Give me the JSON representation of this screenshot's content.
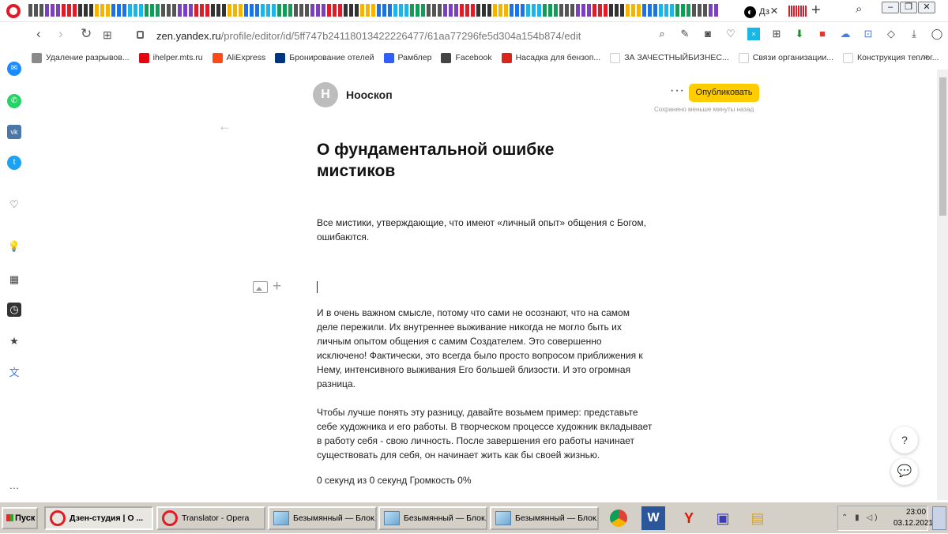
{
  "browser": {
    "active_tab_label": "Дз",
    "url_host": "zen.yandex.ru",
    "url_path": "/profile/editor/id/5ff747b24118013422226477/61aa77296fe5d304a154b874/edit"
  },
  "bookmarks": [
    {
      "label": "Удаление разрывов...",
      "color": "#8a8a8a"
    },
    {
      "label": "ihelper.mts.ru",
      "color": "#e30611"
    },
    {
      "label": "AliExpress",
      "color": "#ff4a17"
    },
    {
      "label": "Бронирование отелей",
      "color": "#003580"
    },
    {
      "label": "Рамблер",
      "color": "#315efb"
    },
    {
      "label": "Facebook",
      "color": "#444444"
    },
    {
      "label": "Насадка для бензоп...",
      "color": "#d9261c"
    },
    {
      "label": "ЗА ЗАЧЕСТНЫЙБИЗНЕС...",
      "color": "#ffffff"
    },
    {
      "label": "Связи организации...",
      "color": "#ffffff"
    },
    {
      "label": "Конструкция теплог...",
      "color": "#ffffff"
    }
  ],
  "editor": {
    "avatar_letter": "Н",
    "channel_name": "Нооскоп",
    "publish_label": "Опубликовать",
    "saved_status": "Сохранено меньше минуты назад",
    "more_label": "···",
    "title": "О фундаментальной ошибке мистиков",
    "paragraphs": [
      "Все мистики, утверждающие, что имеют «личный опыт» общения с Богом, ошибаются.",
      "И в очень важном смысле, потому что сами не осознают, что на самом деле пережили. Их внутреннее выживание никогда не могло быть их личным опытом общения с самим Создателем. Это совершенно исключено! Фактически, это всегда было просто вопросом приближения к Нему, интенсивного выживания Его большей близости. И это огромная разница.",
      "Чтобы лучше понять эту разницу, давайте возьмем пример: представьте себе художника и его работы. В творческом процессе художник вкладывает в работу себя - свою личность. После завершения его работы начинает существовать для себя, он начинает жить как бы своей жизнью."
    ],
    "media_status": "0 секунд из 0 секунд Громкость 0%",
    "help_label": "?"
  },
  "taskbar": {
    "start_label": "Пуск",
    "tasks": [
      {
        "label": "Дзен-студия | О ...",
        "icon": "opera-icon",
        "active": true
      },
      {
        "label": "Translator - Opera",
        "icon": "opera-icon",
        "active": false
      },
      {
        "label": "Безымянный — Блок...",
        "icon": "notepad-icon",
        "active": false
      },
      {
        "label": "Безымянный — Блок...",
        "icon": "notepad-icon",
        "active": false
      },
      {
        "label": "Безымянный — Блок...",
        "icon": "notepad-icon",
        "active": false
      }
    ],
    "clock_time": "23:00",
    "clock_date": "03.12.2021"
  },
  "colors": {
    "publish": "#ffcc00",
    "opera_red": "#e01c28",
    "taskbar": "#d4d0c8"
  }
}
